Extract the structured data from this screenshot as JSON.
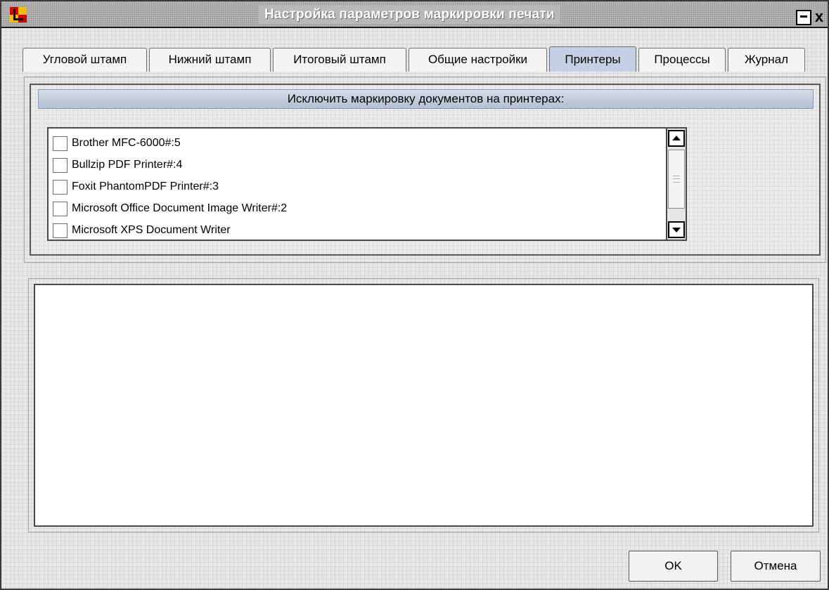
{
  "window": {
    "title": "Настройка параметров маркировки печати",
    "minimize_symbol": "",
    "close_symbol": "x",
    "app_icon": "app-logo-icon"
  },
  "tabs": [
    {
      "label": "Угловой штамп",
      "active": false
    },
    {
      "label": "Нижний штамп",
      "active": false
    },
    {
      "label": "Итоговый штамп",
      "active": false
    },
    {
      "label": "Общие настройки",
      "active": false
    },
    {
      "label": "Принтеры",
      "active": true
    },
    {
      "label": "Процессы",
      "active": false
    },
    {
      "label": "Журнал",
      "active": false
    }
  ],
  "printers": {
    "header": "Исключить маркировку документов на принтерах:",
    "items": [
      {
        "label": "Brother MFC-6000#:5",
        "checked": false
      },
      {
        "label": "Bullzip PDF Printer#:4",
        "checked": false
      },
      {
        "label": "Foxit PhantomPDF Printer#:3",
        "checked": false
      },
      {
        "label": "Microsoft Office Document Image Writer#:2",
        "checked": false
      },
      {
        "label": "Microsoft XPS Document Writer",
        "checked": false
      }
    ]
  },
  "log": {
    "text": ""
  },
  "buttons": {
    "ok": "OK",
    "cancel": "Отмена"
  },
  "colors": {
    "active_tab": "#c3d0e4",
    "header_gradient_top": "#d4dde9",
    "header_gradient_bottom": "#b3c0d2",
    "icon_red": "#d20000",
    "icon_yellow": "#f0c000"
  }
}
